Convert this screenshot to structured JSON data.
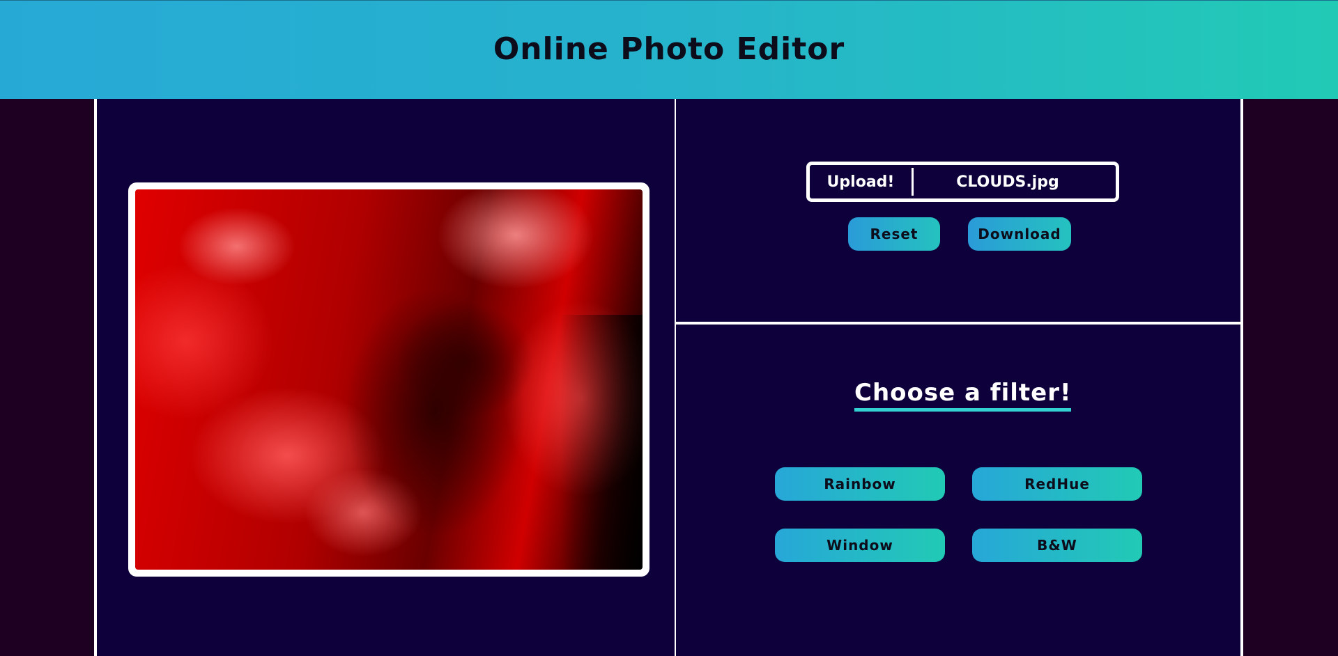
{
  "header": {
    "title": "Online Photo Editor"
  },
  "upload": {
    "label": "Upload!",
    "filename": "CLOUDS.jpg"
  },
  "actions": {
    "reset_label": "Reset",
    "download_label": "Download"
  },
  "filters": {
    "title": "Choose a filter!",
    "items": [
      {
        "label": "Rainbow"
      },
      {
        "label": "RedHue"
      },
      {
        "label": "Window"
      },
      {
        "label": "B&W"
      }
    ]
  },
  "colors": {
    "header_gradient_start": "#27a9d6",
    "header_gradient_end": "#22cab5",
    "panel_background": "#0d003b",
    "page_background": "#1e0022",
    "accent_underline": "#33d1d1"
  },
  "preview": {
    "image_description_icon": "image-preview"
  }
}
